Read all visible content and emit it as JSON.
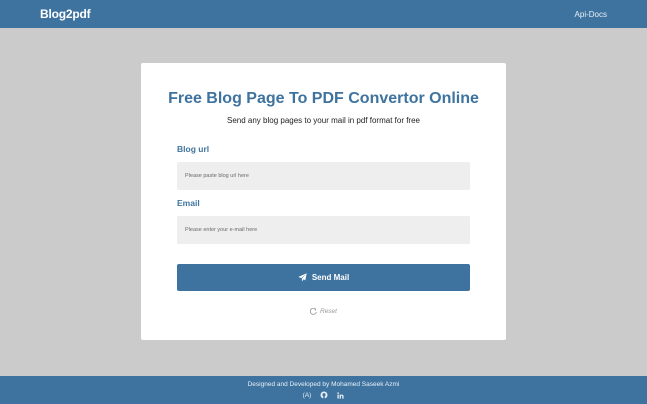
{
  "navbar": {
    "brand": "Blog2pdf",
    "link": "Api-Docs"
  },
  "main": {
    "title": "Free Blog Page To PDF Convertor Online",
    "subtitle": "Send any blog pages to your mail in pdf format for free",
    "blog_url_label": "Blog url",
    "blog_url_placeholder": "Please paste blog url here",
    "blog_url_value": "",
    "email_label": "Email",
    "email_placeholder": "Please enter your e-mail here",
    "email_value": "",
    "send_button": "Send Mail",
    "send_icon": "paper-plane-icon",
    "reset_label": "Reset",
    "reset_icon": "refresh-icon"
  },
  "footer": {
    "credit": "Designed and Developed by Mohamed Saseek Azmi",
    "icons": [
      "avatar-a-icon",
      "github-icon",
      "linkedin-icon"
    ],
    "avatar_text": "(A)"
  },
  "colors": {
    "primary": "#3e739f",
    "background": "#cbcbcb",
    "card": "#ffffff",
    "input_bg": "#eeeeee"
  }
}
